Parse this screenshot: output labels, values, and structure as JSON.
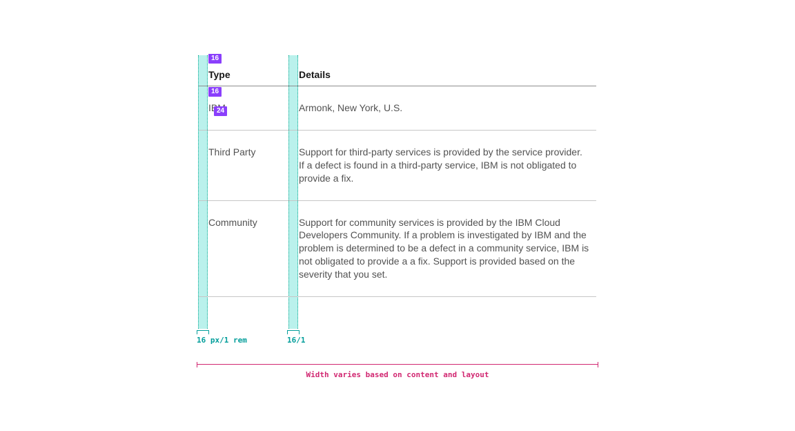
{
  "badges": {
    "top": "16",
    "mid1": "16",
    "mid2": "24"
  },
  "table": {
    "headers": [
      "Type",
      "Details"
    ],
    "rows": [
      {
        "type": "IBM",
        "details": "Armonk, New York, U.S."
      },
      {
        "type": "Third Party",
        "details": "Support for third-party services is provided by the service provider. If a defect is found in a third-party service, IBM is not obligated to provide a fix."
      },
      {
        "type": "Community",
        "details": "Support for community services is provided by the IBM Cloud Developers Community. If a problem is investigated by IBM and the problem is determined to be a defect in a community service, IBM is not obligated to provide a a fix. Support is provided based on the severity that you set."
      }
    ]
  },
  "legend": {
    "tick_a": "16 px/1 rem",
    "tick_b": "16/1",
    "widthcaption": "Width varies based on content and layout"
  }
}
